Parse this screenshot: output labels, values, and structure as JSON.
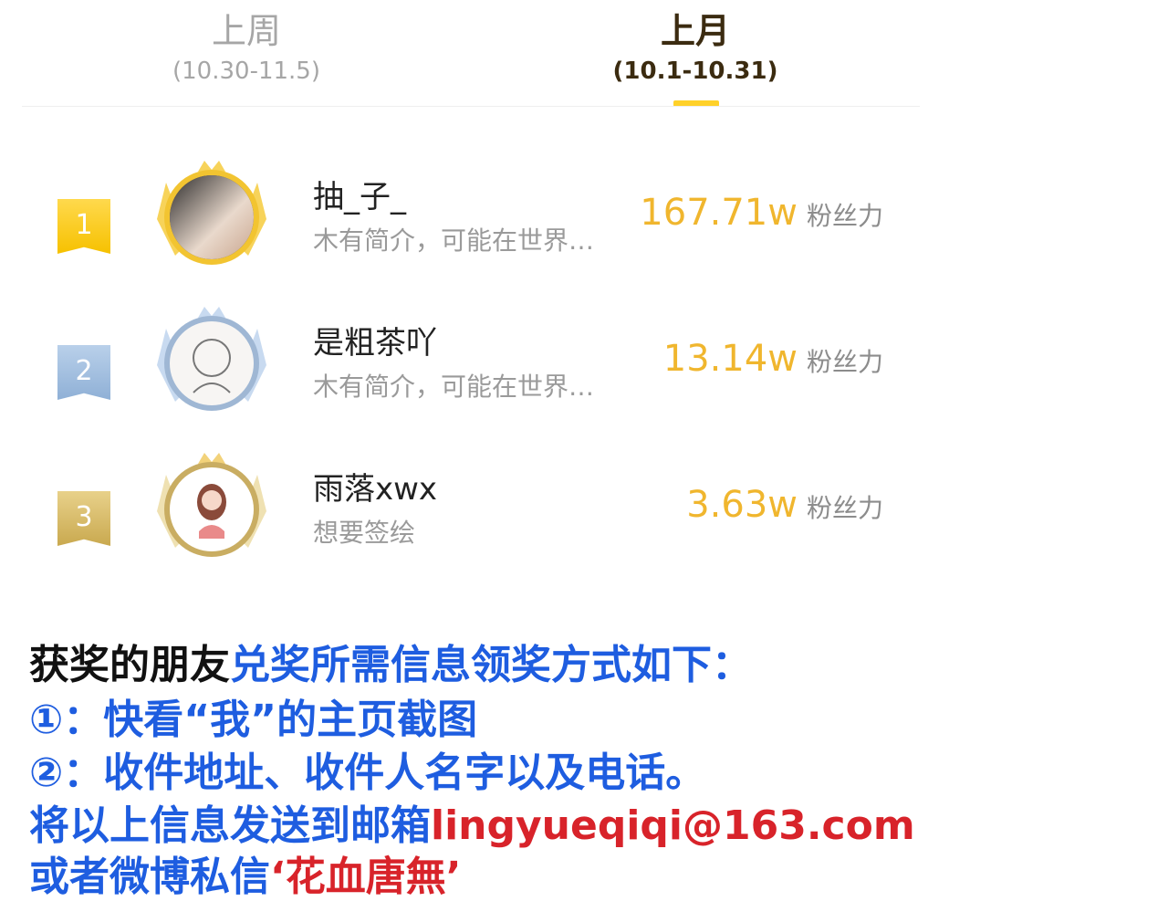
{
  "tabs": [
    {
      "title": "上周",
      "range": "(10.30-11.5)"
    },
    {
      "title": "上月",
      "range": "(10.1-10.31)"
    }
  ],
  "ranking": [
    {
      "rank": "1",
      "name": "抽_子_",
      "bio": "木有简介，可能在世界…",
      "value": "167.71w",
      "unit": "粉丝力"
    },
    {
      "rank": "2",
      "name": "是粗茶吖",
      "bio": "木有简介，可能在世界…",
      "value": "13.14w",
      "unit": "粉丝力"
    },
    {
      "rank": "3",
      "name": "雨落xwx",
      "bio": "想要签绘",
      "value": "3.63w",
      "unit": "粉丝力"
    }
  ],
  "notice": {
    "line1_black": "获奖的朋友",
    "line1_blue": "兑奖所需信息领奖方式如下：",
    "line2": "①：快看“我”的主页截图",
    "line3": "②：收件地址、收件人名字以及电话。",
    "line4_blue": "将以上信息发送到邮箱",
    "line4_red": "lingyueqiqi@163.com",
    "line5_blue": "或者微博私信",
    "line5_red": "‘花血唐無’"
  },
  "colors": {
    "accent_yellow": "#ffd12a",
    "value_orange": "#f0b62e",
    "notice_blue": "#1e5de0",
    "notice_red": "#d8232a"
  }
}
